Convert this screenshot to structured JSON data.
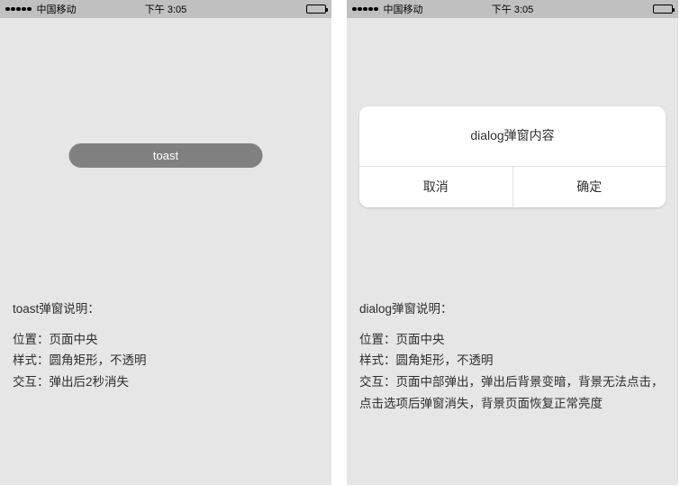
{
  "statusbar": {
    "carrier": "中国移动",
    "time": "下午 3:05"
  },
  "phone1": {
    "toast_label": "toast",
    "desc_title": "toast弹窗说明：",
    "desc_lines": {
      "pos": "位置：页面中央",
      "style": "样式：圆角矩形，不透明",
      "interact": "交互：弹出后2秒消失"
    }
  },
  "phone2": {
    "dialog_text": "dialog弹窗内容",
    "btn_cancel": "取消",
    "btn_confirm": "确定",
    "desc_title": "dialog弹窗说明：",
    "desc_lines": {
      "pos": "位置：页面中央",
      "style": "样式：圆角矩形，不透明",
      "interact": "交互：页面中部弹出，弹出后背景变暗，背景无法点击，点击选项后弹窗消失，背景页面恢复正常亮度"
    }
  }
}
